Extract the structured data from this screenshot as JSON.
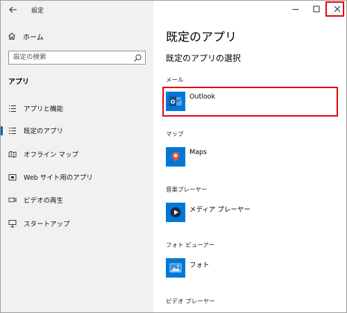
{
  "window": {
    "title": "設定",
    "controls": {
      "minimize": "minimize-icon",
      "maximize": "maximize-icon",
      "close": "close-icon"
    }
  },
  "sidebar": {
    "home_label": "ホーム",
    "search_placeholder": "設定の検索",
    "section_title": "アプリ",
    "items": [
      {
        "label": "アプリと機能",
        "icon": "list-icon"
      },
      {
        "label": "既定のアプリ",
        "icon": "default-apps-icon",
        "selected": true
      },
      {
        "label": "オフライン マップ",
        "icon": "map-icon"
      },
      {
        "label": "Web サイト用のアプリ",
        "icon": "web-app-icon"
      },
      {
        "label": "ビデオの再生",
        "icon": "video-icon"
      },
      {
        "label": "スタートアップ",
        "icon": "startup-icon"
      }
    ]
  },
  "main": {
    "page_title": "既定のアプリ",
    "sub_title": "既定のアプリの選択",
    "categories": [
      {
        "label": "メール",
        "app": "Outlook",
        "icon": "outlook-icon"
      },
      {
        "label": "マップ",
        "app": "Maps",
        "icon": "maps-icon"
      },
      {
        "label": "音楽プレーヤー",
        "app": "メディア プレーヤー",
        "icon": "media-player-icon"
      },
      {
        "label": "フォト ビューアー",
        "app": "フォト",
        "icon": "photos-icon"
      },
      {
        "label": "ビデオ プレーヤー"
      }
    ]
  },
  "colors": {
    "accent": "#0063b1",
    "tile_blue": "#0078d7",
    "highlight_red": "#e30000",
    "sidebar_bg": "#f1f1f1"
  }
}
